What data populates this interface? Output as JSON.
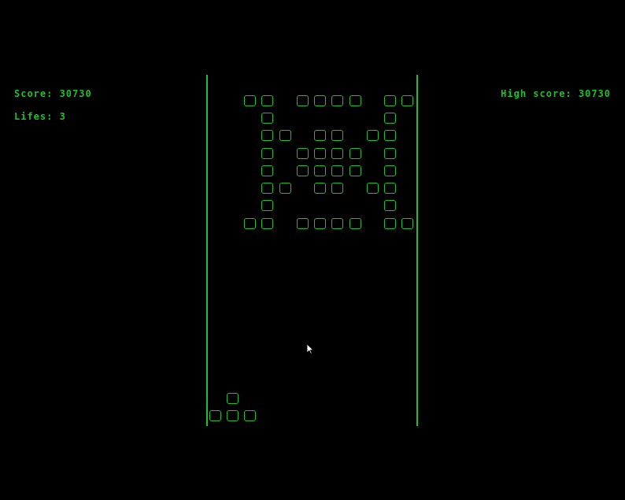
{
  "hud": {
    "score_label": "Score: 30730",
    "lifes_label": "Lifes: 3",
    "high_score_label": "High score: 30730"
  },
  "colors": {
    "accent": "#1fbf2a",
    "background": "#000000"
  },
  "icons": {
    "cursor": "mouse-pointer-icon"
  }
}
